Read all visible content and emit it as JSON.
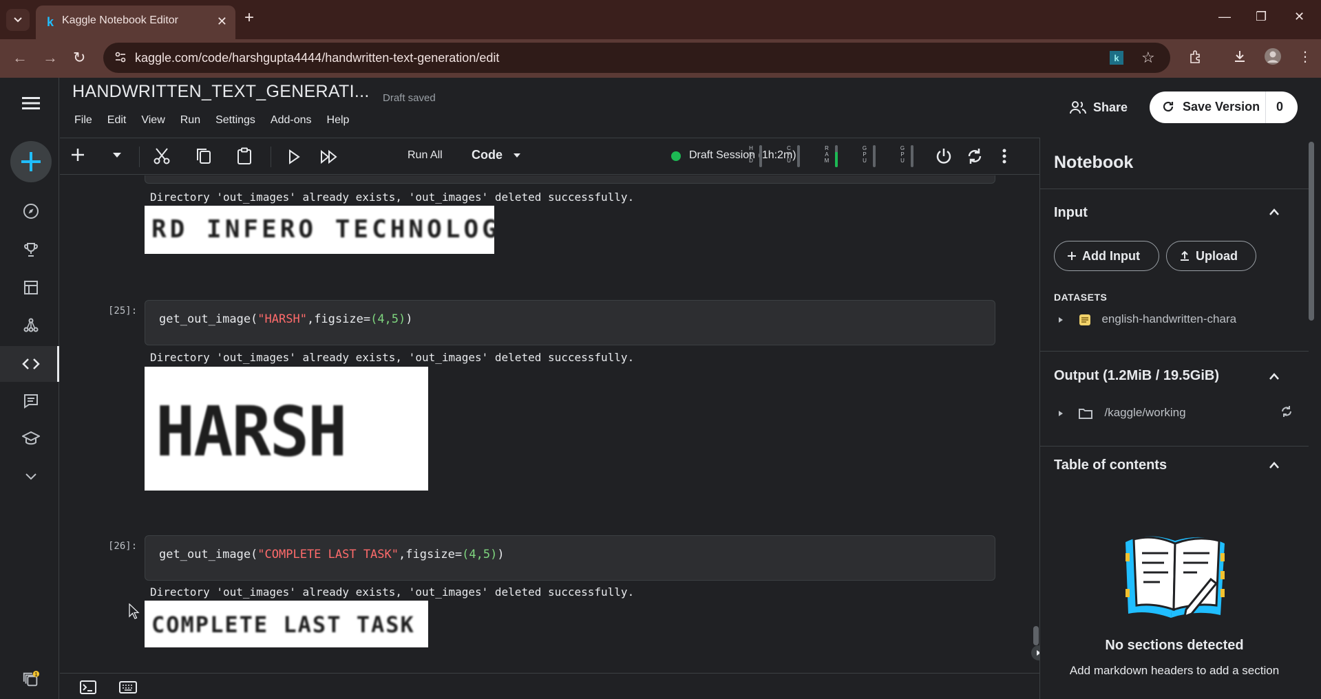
{
  "browser": {
    "tab_title": "Kaggle Notebook Editor",
    "tab_favicon": "k",
    "url": "kaggle.com/code/harshgupta4444/handwritten-text-generation/edit",
    "extension_label": "k"
  },
  "header": {
    "title": "HANDWRITTEN_TEXT_GENERATI...",
    "status": "Draft saved",
    "menu": [
      "File",
      "Edit",
      "View",
      "Run",
      "Settings",
      "Add-ons",
      "Help"
    ],
    "share_label": "Share",
    "save_version_label": "Save Version",
    "save_version_count": "0"
  },
  "toolbar": {
    "run_all_label": "Run All",
    "cell_type": "Code",
    "session_label": "Draft Session (1h:2m)",
    "meters": [
      {
        "label": "HDD",
        "level": 0.0
      },
      {
        "label": "CPU",
        "level": 0.0
      },
      {
        "label": "RAM",
        "level": 0.7
      },
      {
        "label": "GPU",
        "level": 0.0
      },
      {
        "label": "GPU",
        "level": 0.0
      }
    ]
  },
  "cells": [
    {
      "output_text": "Directory 'out_images' already exists, 'out_images' deleted successfully.",
      "image_text": "RD INFERO TECHNOLOGY"
    },
    {
      "prompt": "[25]:",
      "code_fn": "get_out_image(",
      "code_str": "\"HARSH\"",
      "code_mid": ",figsize=",
      "code_args": "(4,5)",
      "code_end": ")",
      "output_text": "Directory 'out_images' already exists, 'out_images' deleted successfully.",
      "image_text": "HARSH"
    },
    {
      "prompt": "[26]:",
      "code_fn": "get_out_image(",
      "code_str": "\"COMPLETE LAST TASK\"",
      "code_mid": ",figsize=",
      "code_args": "(4,5)",
      "code_end": ")",
      "output_text": "Directory 'out_images' already exists, 'out_images' deleted successfully.",
      "image_text": "COMPLETE LAST TASK"
    }
  ],
  "right_panel": {
    "title": "Notebook",
    "input_heading": "Input",
    "add_input_label": "Add Input",
    "upload_label": "Upload",
    "datasets_label": "DATASETS",
    "dataset_name": "english-handwritten-chara",
    "output_heading": "Output (1.2MiB / 19.5GiB)",
    "output_path": "/kaggle/working",
    "toc_heading": "Table of contents",
    "empty_title": "No sections detected",
    "empty_subtitle": "Add markdown headers to add a section"
  },
  "notifications": {
    "badge": "1"
  },
  "colors": {
    "accent": "#20beff",
    "session_green": "#1db954",
    "string": "#ff6b6b",
    "number": "#7fd67f",
    "browser_frame": "#5b3a35"
  }
}
